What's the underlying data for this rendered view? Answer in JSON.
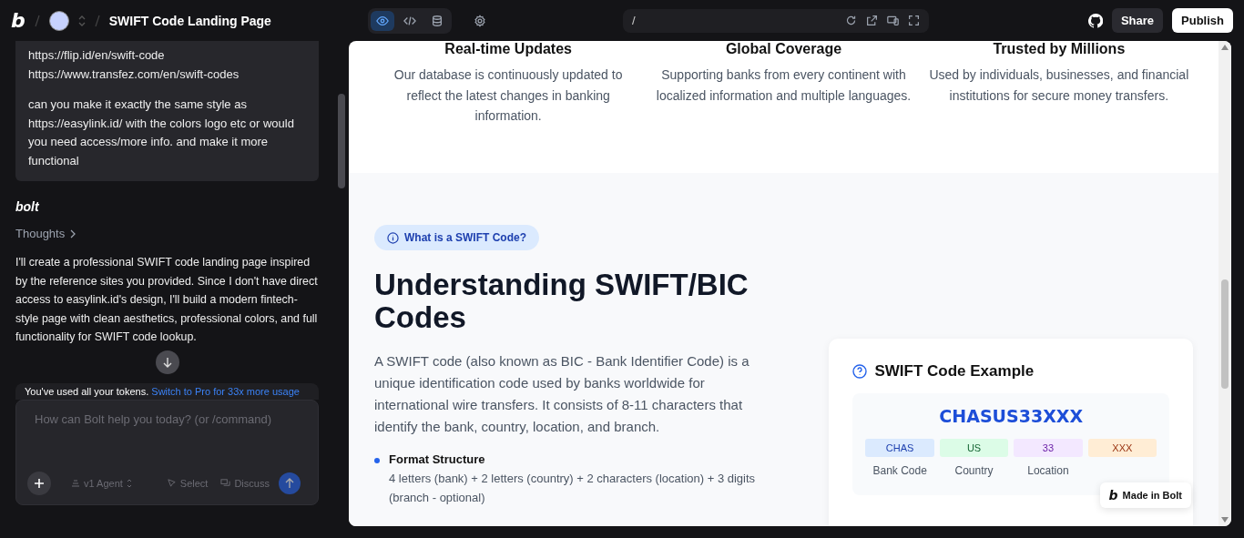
{
  "topbar": {
    "logo": "b",
    "project_title": "SWIFT Code Landing Page",
    "view_tabs": [
      {
        "kind": "preview",
        "selected": true
      },
      {
        "kind": "code",
        "selected": false
      },
      {
        "kind": "database",
        "selected": false
      }
    ],
    "url": "/",
    "share": "Share",
    "publish": "Publish"
  },
  "chat": {
    "user_message": {
      "links": [
        "https://flip.id/en/swift-code",
        "https://www.transfez.com/en/swift-codes"
      ],
      "text": "can you make it exactly the same style as https://easylink.id/ with the colors logo etc or would you need access/more info. and make it more functional"
    },
    "assistant_name": "bolt",
    "thoughts": "Thoughts",
    "reply": "I'll create a professional SWIFT code landing page inspired by the reference sites you provided. Since I don't have direct access to easylink.id's design, I'll build a modern fintech-style page with clean aesthetics, professional colors, and full functionality for SWIFT code lookup.",
    "token_notice": {
      "text": "You've used all your tokens.",
      "link": "Switch to Pro for 33x more usage"
    },
    "input": {
      "placeholder": "How can Bolt help you today? (or /command)"
    },
    "agent": "v1 Agent",
    "select": "Select",
    "discuss": "Discuss"
  },
  "preview": {
    "features": [
      {
        "title": "Real-time Updates",
        "text": "Our database is continuously updated to reflect the latest changes in banking information."
      },
      {
        "title": "Global Coverage",
        "text": "Supporting banks from every continent with localized information and multiple languages."
      },
      {
        "title": "Trusted by Millions",
        "text": "Used by individuals, businesses, and financial institutions for secure money transfers."
      }
    ],
    "badge": "What is a SWIFT Code?",
    "heading": "Understanding SWIFT/BIC Codes",
    "paragraph": "A SWIFT code (also known as BIC - Bank Identifier Code) is a unique identification code used by banks worldwide for international wire transfers. It consists of 8-11 characters that identify the bank, country, location, and branch.",
    "bullets": [
      {
        "title": "Format Structure",
        "text": "4 letters (bank) + 2 letters (country) + 2 characters (location) + 3 digits (branch - optional)"
      }
    ],
    "example_card": {
      "title": "SWIFT Code Example",
      "code": "CHASUS33XXX",
      "parts": [
        {
          "code": "CHAS",
          "label": "Bank Code",
          "color": "#dbeafe"
        },
        {
          "code": "US",
          "label": "Country",
          "color": "#dcfce7"
        },
        {
          "code": "33",
          "label": "Location",
          "color": "#f3e8ff"
        },
        {
          "code": "XXX",
          "color": "#ffedd5"
        }
      ]
    },
    "made_in": {
      "logo": "b",
      "text": "Made in Bolt"
    }
  }
}
